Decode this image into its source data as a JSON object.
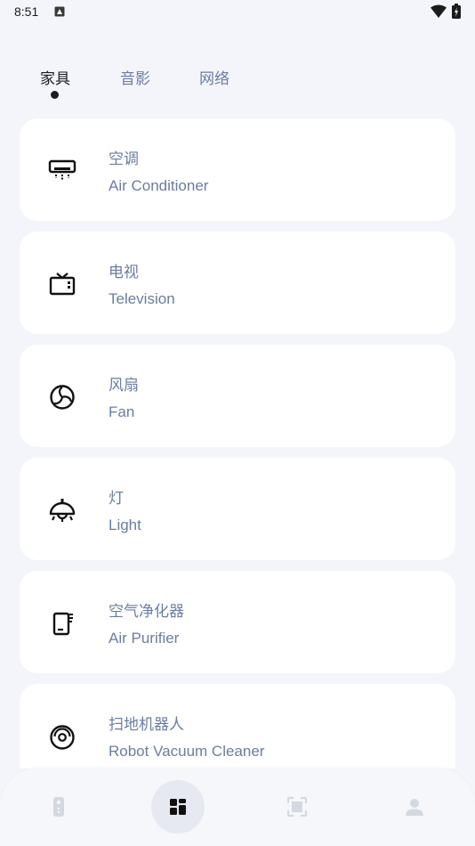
{
  "status_bar": {
    "time": "8:51",
    "icons": [
      "notification-icon",
      "wifi-icon",
      "battery-icon"
    ]
  },
  "tabs": [
    {
      "label": "家具",
      "active": true
    },
    {
      "label": "音影",
      "active": false
    },
    {
      "label": "网络",
      "active": false
    }
  ],
  "devices": [
    {
      "name": "空调",
      "name_en": "Air Conditioner",
      "icon": "air-conditioner-icon"
    },
    {
      "name": "电视",
      "name_en": "Television",
      "icon": "television-icon"
    },
    {
      "name": "风扇",
      "name_en": "Fan",
      "icon": "fan-icon"
    },
    {
      "name": "灯",
      "name_en": "Light",
      "icon": "light-icon"
    },
    {
      "name": "空气净化器",
      "name_en": "Air Purifier",
      "icon": "air-purifier-icon"
    },
    {
      "name": "扫地机器人",
      "name_en": "Robot Vacuum Cleaner",
      "icon": "robot-vacuum-icon"
    }
  ],
  "bottom_nav": [
    {
      "icon": "remote-icon",
      "active": false
    },
    {
      "icon": "dashboard-icon",
      "active": true
    },
    {
      "icon": "scan-icon",
      "active": false
    },
    {
      "icon": "profile-icon",
      "active": false
    }
  ],
  "colors": {
    "background": "#f3f5fa",
    "card": "#ffffff",
    "accent_text": "#6b7da2",
    "primary_text": "#1b1d22",
    "nav_inactive": "#d3d8e2"
  }
}
